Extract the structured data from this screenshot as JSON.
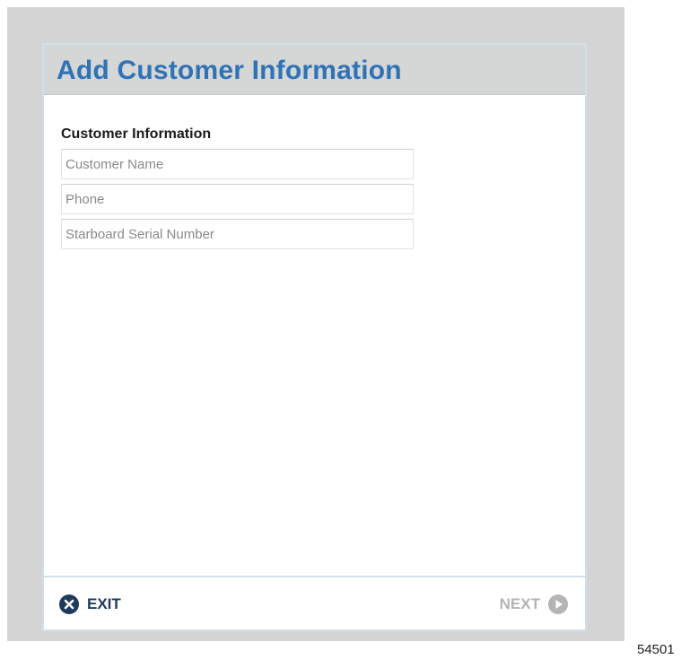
{
  "dialog": {
    "title": "Add Customer Information"
  },
  "customer_info": {
    "section_label": "Customer Information",
    "fields": [
      {
        "placeholder": "Customer Name",
        "value": ""
      },
      {
        "placeholder": "Phone",
        "value": ""
      },
      {
        "placeholder": "Starboard Serial Number",
        "value": ""
      }
    ]
  },
  "footer": {
    "exit_label": "EXIT",
    "exit_icon": "close-circle-icon",
    "next_label": "NEXT",
    "next_icon": "play-circle-icon",
    "next_enabled": false
  },
  "figure_number": "54501",
  "colors": {
    "title": "#2f73b6",
    "header_bg": "#d5d6d6",
    "screen_bg": "#d4d4d4",
    "exit_icon": "#1f3a5c",
    "next_disabled": "#b4b4b4"
  }
}
